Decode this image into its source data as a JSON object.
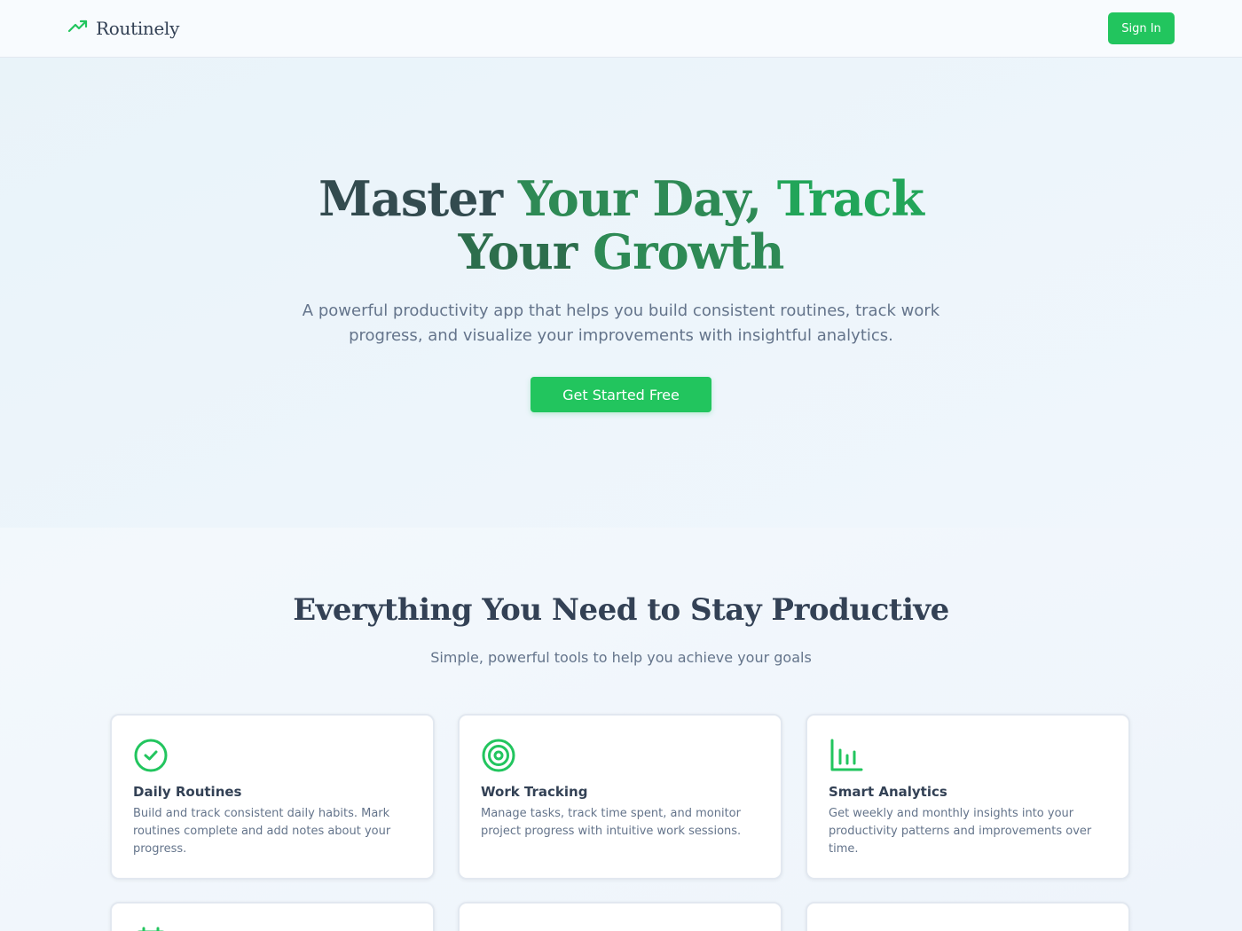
{
  "brand": {
    "name": "Routinely",
    "icon": "trending-up-icon",
    "accent_color": "#22c55e"
  },
  "nav": {
    "signin_label": "Sign In"
  },
  "hero": {
    "title_line1": {
      "w1": "Master",
      "w2": "Your",
      "w3": "Day,",
      "w4": "Track"
    },
    "title_line2": {
      "w1": "Your",
      "w2": "Growth"
    },
    "subtitle": "A powerful productivity app that helps you build consistent routines, track work progress, and visualize your improvements with insightful analytics.",
    "cta_label": "Get Started Free"
  },
  "features": {
    "title": "Everything You Need to Stay Productive",
    "subtitle": "Simple, powerful tools to help you achieve your goals",
    "cards": [
      {
        "icon": "check-circle-icon",
        "title": "Daily Routines",
        "description": "Build and track consistent daily habits. Mark routines complete and add notes about your progress."
      },
      {
        "icon": "target-icon",
        "title": "Work Tracking",
        "description": "Manage tasks, track time spent, and monitor project progress with intuitive work sessions."
      },
      {
        "icon": "bar-chart-icon",
        "title": "Smart Analytics",
        "description": "Get weekly and monthly insights into your productivity patterns and improvements over time."
      },
      {
        "icon": "calendar-icon"
      },
      {},
      {}
    ]
  }
}
